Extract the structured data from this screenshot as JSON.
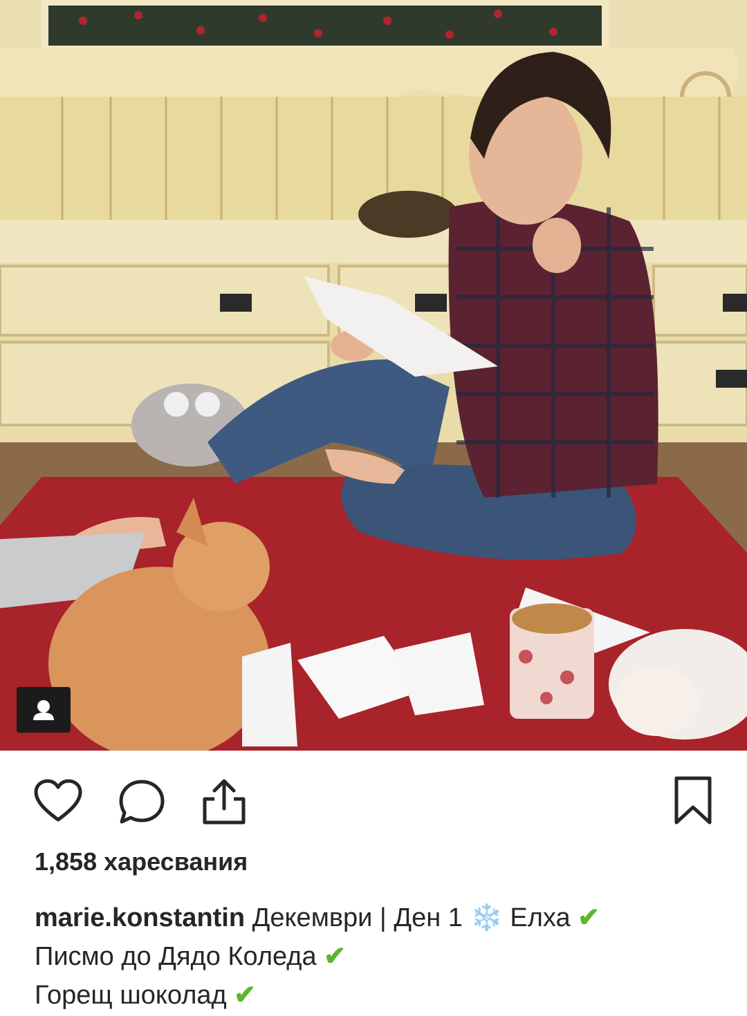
{
  "post": {
    "image_alt": "Girl in plaid shirt reading a letter on a red rug with a cat",
    "likes_count": "1,858",
    "likes_label": "харесвания",
    "username": "marie.konstantin",
    "caption_line1": "Декември | Ден 1",
    "snowflake": "❄️",
    "caption_line1b": "Елха",
    "caption_line2": "Писмо до Дядо Коледа",
    "caption_line3": "Горещ шоколад",
    "check": "✔"
  },
  "icons": {
    "like": "heart-icon",
    "comment": "comment-icon",
    "share": "share-icon",
    "save": "bookmark-icon",
    "tag": "person-tag-icon"
  },
  "colors": {
    "rug": "#a8232a",
    "wood": "#e9dcae",
    "check": "#5db62c"
  }
}
